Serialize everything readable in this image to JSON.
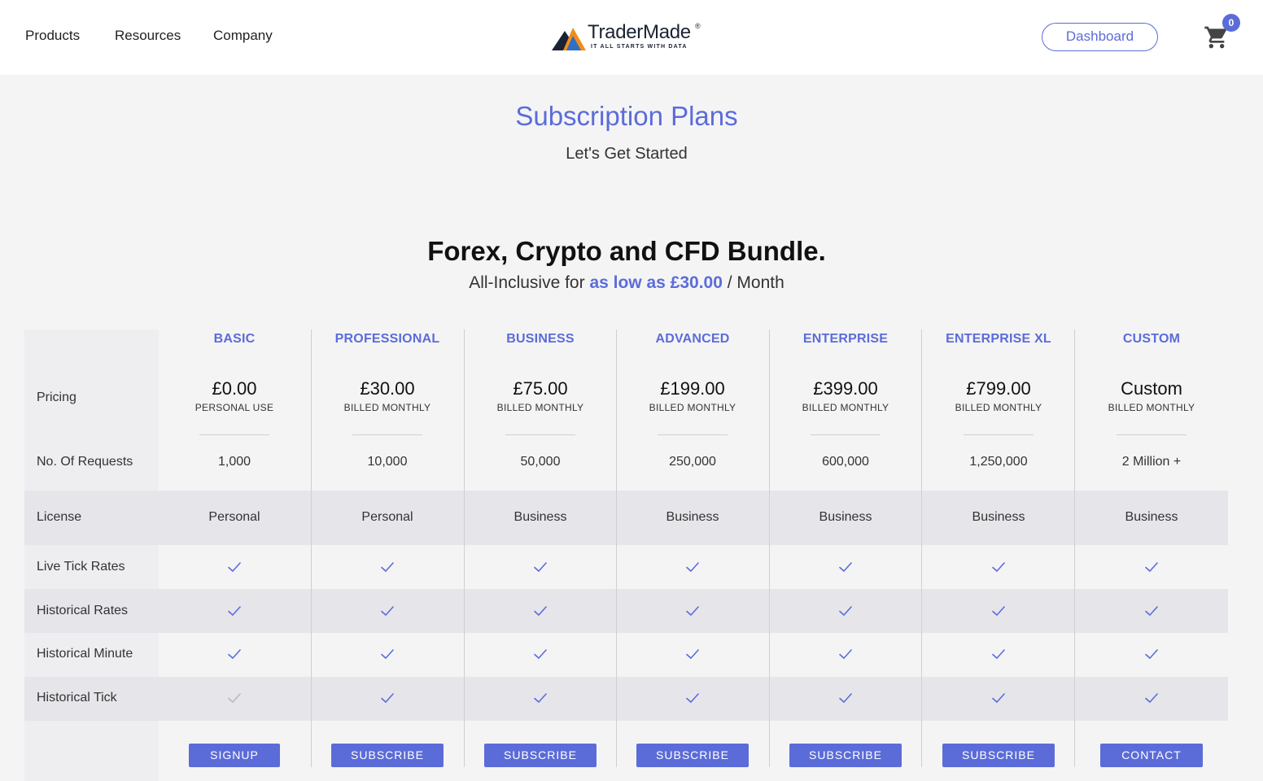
{
  "nav": {
    "items": [
      "Products",
      "Resources",
      "Company"
    ],
    "logo_text": "TraderMade",
    "logo_reg": "®",
    "logo_tagline": "IT ALL STARTS WITH DATA",
    "dashboard_label": "Dashboard",
    "cart_count": "0"
  },
  "hero": {
    "title": "Subscription Plans",
    "subtitle": "Let's Get Started"
  },
  "bundle": {
    "title": "Forex, Crypto and CFD Bundle.",
    "sub_prefix": "All-Inclusive for ",
    "sub_highlight": "as low as £30.00",
    "sub_suffix": " / Month"
  },
  "row_labels": {
    "pricing": "Pricing",
    "requests": "No. Of Requests",
    "license": "License",
    "live": "Live Tick Rates",
    "hist_rates": "Historical Rates",
    "hist_minute": "Historical Minute",
    "hist_tick": "Historical Tick"
  },
  "plans": [
    {
      "name": "BASIC",
      "price": "£0.00",
      "billing": "PERSONAL USE",
      "requests": "1,000",
      "license": "Personal",
      "live": true,
      "hist_rates": true,
      "hist_minute": true,
      "hist_tick": false,
      "button": "SIGNUP"
    },
    {
      "name": "PROFESSIONAL",
      "price": "£30.00",
      "billing": "BILLED MONTHLY",
      "requests": "10,000",
      "license": "Personal",
      "live": true,
      "hist_rates": true,
      "hist_minute": true,
      "hist_tick": true,
      "button": "SUBSCRIBE"
    },
    {
      "name": "BUSINESS",
      "price": "£75.00",
      "billing": "BILLED MONTHLY",
      "requests": "50,000",
      "license": "Business",
      "live": true,
      "hist_rates": true,
      "hist_minute": true,
      "hist_tick": true,
      "button": "SUBSCRIBE"
    },
    {
      "name": "ADVANCED",
      "price": "£199.00",
      "billing": "BILLED MONTHLY",
      "requests": "250,000",
      "license": "Business",
      "live": true,
      "hist_rates": true,
      "hist_minute": true,
      "hist_tick": true,
      "button": "SUBSCRIBE"
    },
    {
      "name": "ENTERPRISE",
      "price": "£399.00",
      "billing": "BILLED MONTHLY",
      "requests": "600,000",
      "license": "Business",
      "live": true,
      "hist_rates": true,
      "hist_minute": true,
      "hist_tick": true,
      "button": "SUBSCRIBE"
    },
    {
      "name": "ENTERPRISE XL",
      "price": "£799.00",
      "billing": "BILLED MONTHLY",
      "requests": "1,250,000",
      "license": "Business",
      "live": true,
      "hist_rates": true,
      "hist_minute": true,
      "hist_tick": true,
      "button": "SUBSCRIBE"
    },
    {
      "name": "CUSTOM",
      "price": "Custom",
      "billing": "BILLED MONTHLY",
      "requests": "2 Million +",
      "license": "Business",
      "live": true,
      "hist_rates": true,
      "hist_minute": true,
      "hist_tick": true,
      "button": "CONTACT"
    }
  ],
  "colors": {
    "accent": "#5b6cd9",
    "check_active": "#5b6cd9",
    "check_inactive": "#b8b8bd"
  }
}
